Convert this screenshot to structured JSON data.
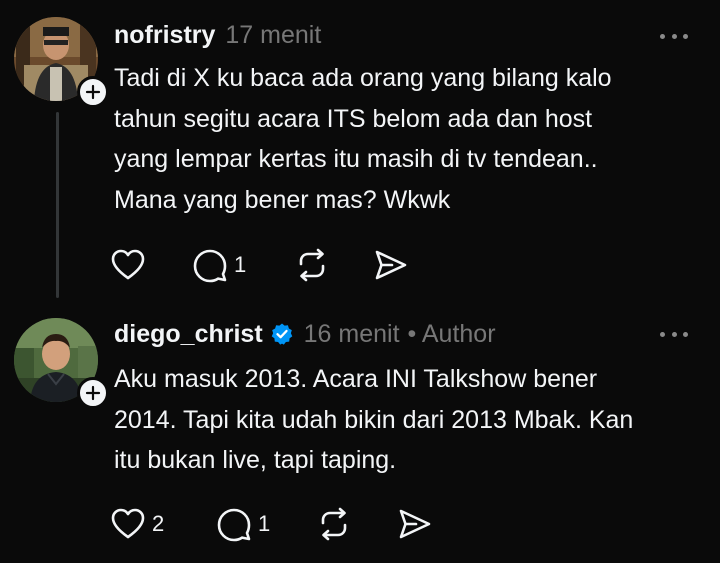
{
  "colors": {
    "background": "#0a0a0a",
    "text": "#f3f5f7",
    "muted": "#777777",
    "verified": "#0095f6",
    "thread_line": "#333638"
  },
  "posts": [
    {
      "username": "nofristry",
      "time": "17 menit",
      "author_tag": "",
      "verified": false,
      "lines": [
        "Tadi di X ku baca ada orang yang bilang kalo",
        "tahun segitu acara ITS belom ada dan host",
        "yang lempar kertas itu masih di tv tendean..",
        "Mana yang bener mas? Wkwk"
      ],
      "likes": "",
      "replies": "1",
      "icons": [
        "heart-icon",
        "comment-icon",
        "repost-icon",
        "share-icon",
        "more-icon",
        "follow-plus-icon"
      ]
    },
    {
      "username": "diego_christ",
      "time": "16 menit",
      "author_tag": "• Author",
      "verified": true,
      "lines": [
        "Aku masuk 2013. Acara INI Talkshow bener",
        "2014. Tapi kita udah bikin dari 2013 Mbak. Kan",
        "itu bukan live, tapi taping."
      ],
      "likes": "2",
      "replies": "1",
      "icons": [
        "verified-badge-icon",
        "heart-icon",
        "comment-icon",
        "repost-icon",
        "share-icon",
        "more-icon",
        "follow-plus-icon"
      ]
    }
  ]
}
